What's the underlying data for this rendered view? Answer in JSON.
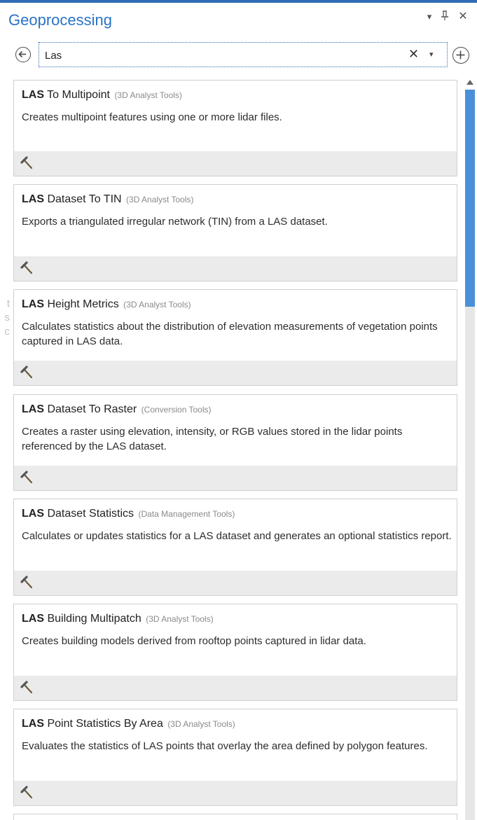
{
  "window": {
    "title": "Geoprocessing",
    "controls": {
      "dropdown_glyph": "▾",
      "pin_glyph": "ᵠ",
      "close_glyph": "✕"
    }
  },
  "search": {
    "back_icon": "arrow-left-circle-icon",
    "value": "Las",
    "clear_glyph": "✕",
    "dropdown_glyph": "▾",
    "add_icon": "plus-circle-icon"
  },
  "results": [
    {
      "prefix": "LAS",
      "name": " To Multipoint",
      "toolbox": "(3D Analyst Tools)",
      "description": "Creates multipoint features using one or more lidar files.",
      "icon": "hammer-icon"
    },
    {
      "prefix": "LAS",
      "name": " Dataset To TIN",
      "toolbox": "(3D Analyst Tools)",
      "description": "Exports a triangulated irregular network (TIN) from a  LAS dataset.",
      "icon": "hammer-icon"
    },
    {
      "prefix": "LAS",
      "name": " Height Metrics",
      "toolbox": "(3D Analyst Tools)",
      "description": "Calculates statistics about the distribution of elevation measurements of vegetation points captured in LAS data.",
      "icon": "hammer-icon"
    },
    {
      "prefix": "LAS",
      "name": " Dataset To Raster",
      "toolbox": "(Conversion Tools)",
      "description": "Creates  a raster using elevation, intensity,  or RGB values stored in the lidar points referenced by the LAS dataset.",
      "icon": "hammer-icon"
    },
    {
      "prefix": "LAS",
      "name": " Dataset Statistics",
      "toolbox": "(Data Management Tools)",
      "description": "Calculates or updates statistics for a LAS dataset and generates an optional statistics report.",
      "icon": "hammer-icon"
    },
    {
      "prefix": "LAS",
      "name": " Building Multipatch",
      "toolbox": "(3D Analyst Tools)",
      "description": "Creates building models derived from rooftop points captured in lidar data.",
      "icon": "hammer-icon"
    },
    {
      "prefix": "LAS",
      "name": " Point Statistics By Area",
      "toolbox": "(3D Analyst Tools)",
      "description": "Evaluates the statistics of LAS points that overlay the area defined by polygon features.",
      "icon": "hammer-icon"
    }
  ],
  "background_text": [
    "t",
    "s",
    "c"
  ],
  "colors": {
    "accent": "#2f6db5",
    "title": "#2a73c4",
    "scroll_thumb": "#4a90d9",
    "card_footer": "#ebebeb"
  }
}
